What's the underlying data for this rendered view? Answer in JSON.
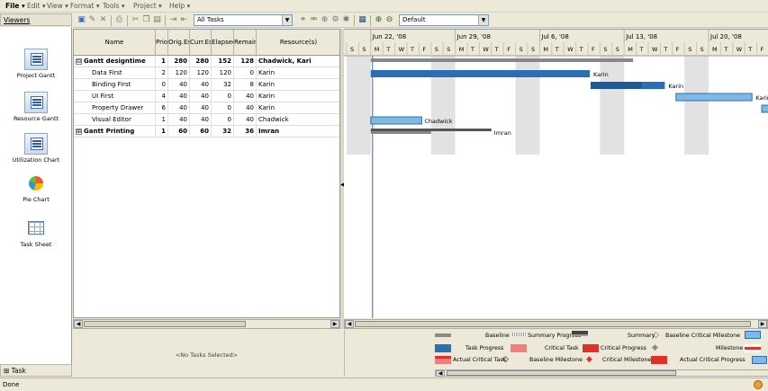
{
  "menubar": {
    "items": [
      "File ▾",
      "Edit ▾",
      "View ▾",
      "Format ▾",
      "Tools ▾",
      "Project ▾",
      "Help ▾"
    ]
  },
  "viewers": {
    "title": "Viewers",
    "items": [
      "Project Gantt",
      "Resource Gantt",
      "Utilization Chart",
      "Pie Chart",
      "Task Sheet"
    ]
  },
  "task_panel": {
    "label": "⊞ Task"
  },
  "toolbar": {
    "filter_value": "All Tasks",
    "zoom_preset": "Default"
  },
  "table": {
    "columns": [
      "Name",
      "Prio",
      "Orig.Est",
      "Curr.Est",
      "Elapsed",
      "Remain",
      "Resource(s)"
    ],
    "rows": [
      {
        "expander": "⊟",
        "name": "Gantt designtime",
        "prio": "1",
        "orig": "280",
        "curr": "280",
        "elapsed": "152",
        "remain": "128",
        "resource": "Chadwick, Kari",
        "bold": true
      },
      {
        "expander": "",
        "name": "Data First",
        "prio": "2",
        "orig": "120",
        "curr": "120",
        "elapsed": "120",
        "remain": "0",
        "resource": "Karin",
        "bold": false
      },
      {
        "expander": "",
        "name": "Binding First",
        "prio": "0",
        "orig": "40",
        "curr": "40",
        "elapsed": "32",
        "remain": "8",
        "resource": "Karin",
        "bold": false
      },
      {
        "expander": "",
        "name": "UI First",
        "prio": "4",
        "orig": "40",
        "curr": "40",
        "elapsed": "0",
        "remain": "40",
        "resource": "Karin",
        "bold": false
      },
      {
        "expander": "",
        "name": "Property Drawer",
        "prio": "6",
        "orig": "40",
        "curr": "40",
        "elapsed": "0",
        "remain": "40",
        "resource": "Karin",
        "bold": false
      },
      {
        "expander": "",
        "name": "Visual Editor",
        "prio": "1",
        "orig": "40",
        "curr": "40",
        "elapsed": "0",
        "remain": "40",
        "resource": "Chadwick",
        "bold": false
      },
      {
        "expander": "⊞",
        "name": "Gantt Printing",
        "prio": "1",
        "orig": "60",
        "curr": "60",
        "elapsed": "32",
        "remain": "36",
        "resource": "Imran",
        "bold": true
      }
    ]
  },
  "timescale": {
    "weeks": [
      "Jun 22, '08",
      "Jun 29, '08",
      "Jul 6, '08",
      "Jul 13, '08",
      "Jul 20, '08"
    ],
    "day_letters": [
      "S",
      "S",
      "M",
      "T",
      "W",
      "T",
      "F"
    ]
  },
  "gantt_labels": {
    "data_first": "Karin",
    "binding_first": "Karin",
    "ui_first": "Karin",
    "visual_editor": "Chadwick",
    "printing": "Imran"
  },
  "selection_text": "<No Tasks Selected>",
  "legend": {
    "baseline": "Baseline",
    "summary_progress": "Summary Progress",
    "summary": "Summary",
    "baseline_critical_milestone": "Baseline Critical Milestone",
    "task_progress": "Task Progress",
    "critical_task": "Critical Task",
    "critical_progress": "Critical Progress",
    "milestone": "Milestone",
    "actual_critical_task": "Actual Critical Task",
    "baseline_milestone": "Baseline Milestone",
    "critical_milestone": "Critical Milestone",
    "actual_critical_progress": "Actual Critical Progress",
    "colors": {
      "task": "#2a6fb5",
      "critical": "#e0302a",
      "baseline": "#888888",
      "actual_critical": "#f08080",
      "critical_progress_light": "#7fb8e0"
    }
  },
  "status": {
    "text": "Done"
  }
}
